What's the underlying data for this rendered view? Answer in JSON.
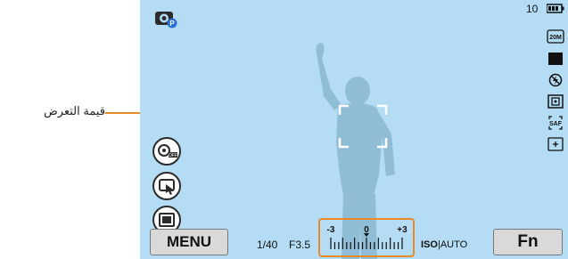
{
  "annotation": {
    "label": "قيمة التعرض",
    "highlight_color": "#e88a2a"
  },
  "status": {
    "shots_remaining": "10",
    "battery": "battery-icon",
    "resolution": "20M",
    "icons": [
      "photo-size-icon",
      "flash-off-icon",
      "metering-icon",
      "single-af-icon",
      "ev-plus-icon"
    ],
    "af_mode": "SAF"
  },
  "left_icons": [
    "smart-auto-mode-icon",
    "ois-off-icon",
    "touch-af-icon",
    "display-frame-icon"
  ],
  "mode_badge": "P",
  "buttons": {
    "menu": "MENU",
    "fn": "Fn"
  },
  "exposure": {
    "shutter": "1/40",
    "aperture": "F3.5",
    "iso_label": "ISO",
    "iso_value": "AUTO",
    "ev_min": "-3",
    "ev_zero": "0",
    "ev_max": "+3",
    "ev_value": 0
  },
  "colors": {
    "screen_bg": "#b4dcf4",
    "silhouette": "#8fbdd6",
    "accent": "#e88a2a"
  }
}
